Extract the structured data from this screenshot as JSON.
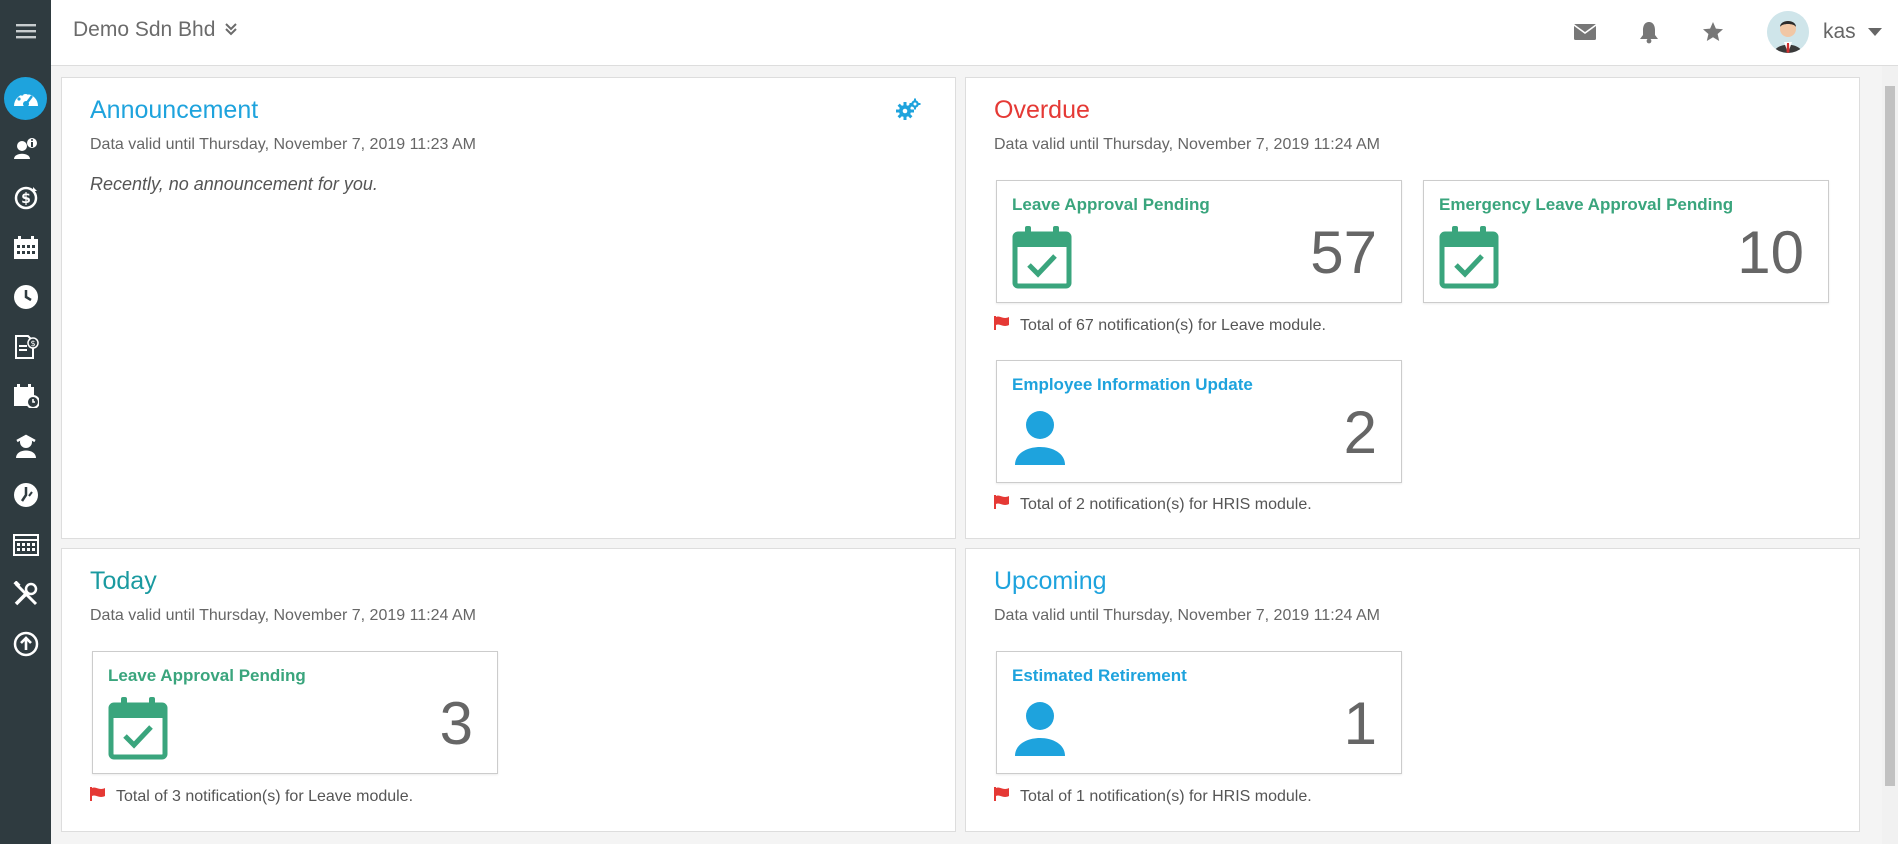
{
  "topbar": {
    "company": "Demo Sdn Bhd",
    "username": "kas"
  },
  "sidebar": {
    "items": [
      {
        "icon": "dashboard-icon"
      },
      {
        "icon": "employee-info-icon"
      },
      {
        "icon": "payroll-icon"
      },
      {
        "icon": "calendar-icon"
      },
      {
        "icon": "clock-icon"
      },
      {
        "icon": "claim-document-icon"
      },
      {
        "icon": "schedule-icon"
      },
      {
        "icon": "training-icon"
      },
      {
        "icon": "timesheet-icon"
      },
      {
        "icon": "roster-icon"
      },
      {
        "icon": "tools-icon"
      },
      {
        "icon": "upload-icon"
      }
    ]
  },
  "announcement": {
    "title": "Announcement",
    "subtitle": "Data valid until Thursday, November 7, 2019 11:23 AM",
    "message": "Recently, no announcement for you."
  },
  "overdue": {
    "title": "Overdue",
    "subtitle": "Data valid until Thursday, November 7, 2019 11:24 AM",
    "cards": [
      {
        "title": "Leave Approval Pending",
        "value": "57"
      },
      {
        "title": "Emergency Leave Approval Pending",
        "value": "10"
      },
      {
        "title": "Employee Information Update",
        "value": "2"
      }
    ],
    "notes": [
      "Total of 67 notification(s) for Leave module.",
      "Total of 2 notification(s) for HRIS module."
    ]
  },
  "today": {
    "title": "Today",
    "subtitle": "Data valid until Thursday, November 7, 2019 11:24 AM",
    "cards": [
      {
        "title": "Leave Approval Pending",
        "value": "3"
      }
    ],
    "notes": [
      "Total of 3 notification(s) for Leave module."
    ]
  },
  "upcoming": {
    "title": "Upcoming",
    "subtitle": "Data valid until Thursday, November 7, 2019 11:24 AM",
    "cards": [
      {
        "title": "Estimated Retirement",
        "value": "1"
      }
    ],
    "notes": [
      "Total of 1 notification(s) for HRIS module."
    ]
  },
  "colors": {
    "sidebar_bg": "#2f3b40",
    "accent_blue": "#1ea3dd",
    "leave_green": "#3aa57d",
    "overdue_red": "#e53935",
    "today_teal": "#1a9aa0"
  }
}
